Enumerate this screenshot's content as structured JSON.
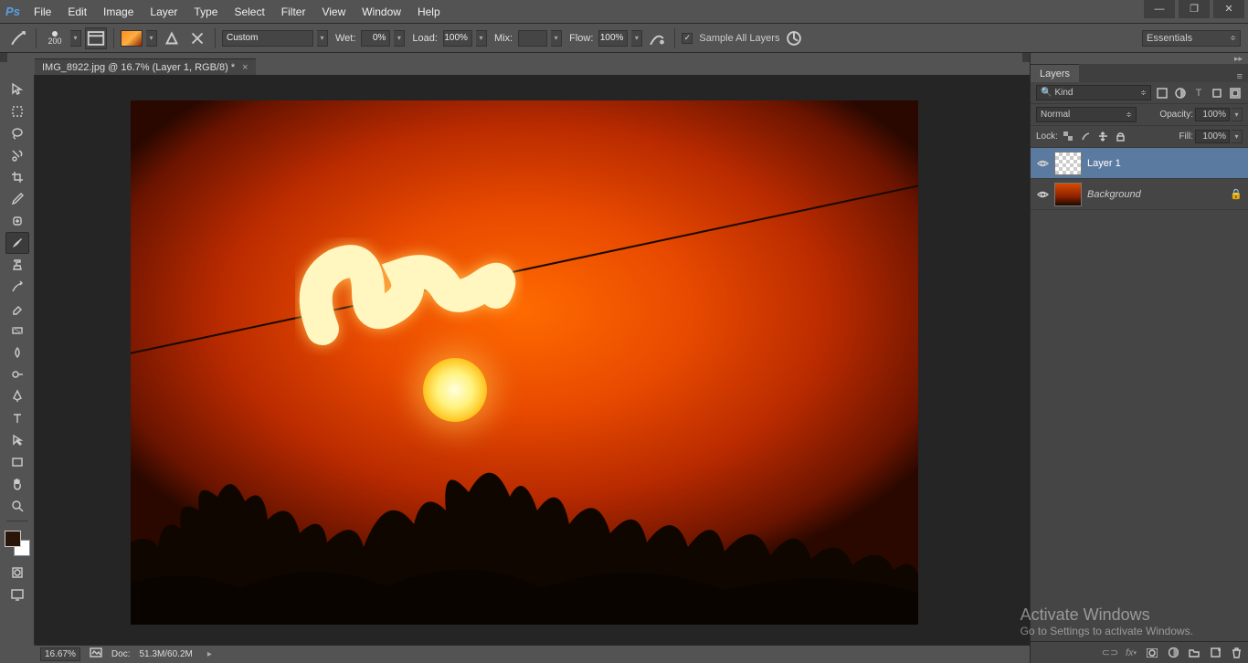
{
  "menu": {
    "items": [
      "File",
      "Edit",
      "Image",
      "Layer",
      "Type",
      "Select",
      "Filter",
      "View",
      "Window",
      "Help"
    ]
  },
  "options": {
    "brush_size": "200",
    "preset": "Custom",
    "wet_label": "Wet:",
    "wet_value": "0%",
    "load_label": "Load:",
    "load_value": "100%",
    "mix_label": "Mix:",
    "mix_value": "",
    "flow_label": "Flow:",
    "flow_value": "100%",
    "sample_all": "Sample All Layers",
    "workspace": "Essentials"
  },
  "tab": {
    "title": "IMG_8922.jpg @ 16.7% (Layer 1, RGB/8) *"
  },
  "status": {
    "zoom": "16.67%",
    "doc_label": "Doc:",
    "doc": "51.3M/60.2M"
  },
  "panels": {
    "layers": {
      "tab": "Layers",
      "filter_kind": "Kind",
      "blend_mode": "Normal",
      "opacity_label": "Opacity:",
      "opacity_value": "100%",
      "lock_label": "Lock:",
      "fill_label": "Fill:",
      "fill_value": "100%",
      "items": [
        {
          "name": "Layer 1",
          "selected": true,
          "bg": false
        },
        {
          "name": "Background",
          "selected": false,
          "bg": true,
          "locked": true
        }
      ]
    }
  },
  "watermark": {
    "l1": "Activate Windows",
    "l2": "Go to Settings to activate Windows."
  }
}
